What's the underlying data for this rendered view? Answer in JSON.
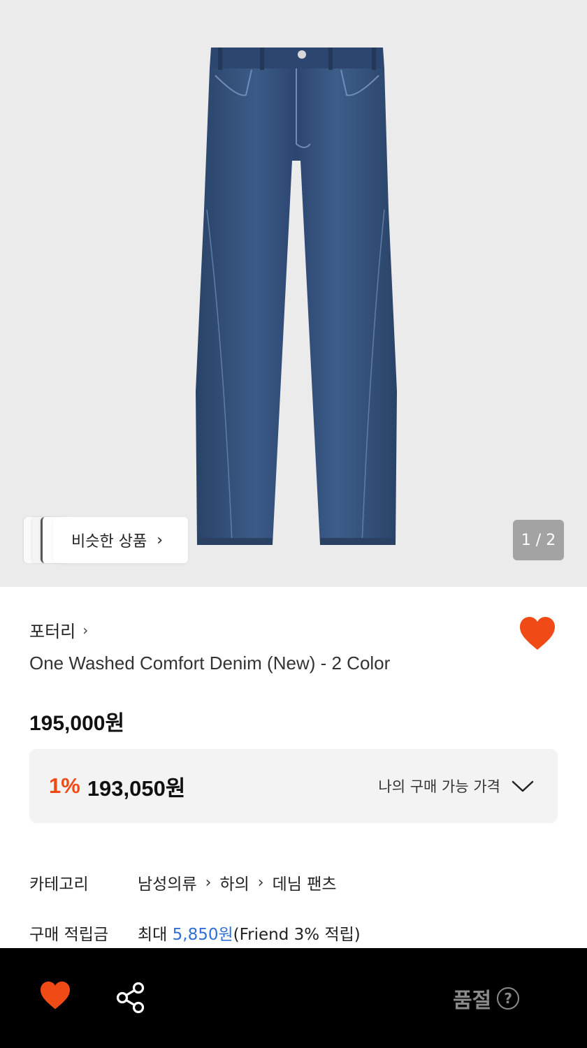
{
  "gallery": {
    "image_alt": "blue-denim-jeans",
    "similar_label": "비슷한 상품",
    "counter": "1 / 2"
  },
  "product": {
    "brand": "포터리",
    "title": "One Washed Comfort Denim (New) - 2 Color",
    "price": "195,000원",
    "wishlisted": true
  },
  "my_price": {
    "discount": "1%",
    "price": "193,050원",
    "label": "나의 구매 가능 가격"
  },
  "details": {
    "category_key": "카테고리",
    "category_path": [
      "남성의류",
      "하의",
      "데님 팬츠"
    ],
    "points_key": "구매 적립금",
    "points_prefix": "최대 ",
    "points_amount": "5,850원",
    "points_suffix": "(Friend 3% 적립)"
  },
  "bottom_bar": {
    "status": "품절",
    "help_symbol": "?"
  },
  "colors": {
    "accent": "#f04a16",
    "link_blue": "#2f6fd6",
    "denim": "#2e4a73"
  }
}
